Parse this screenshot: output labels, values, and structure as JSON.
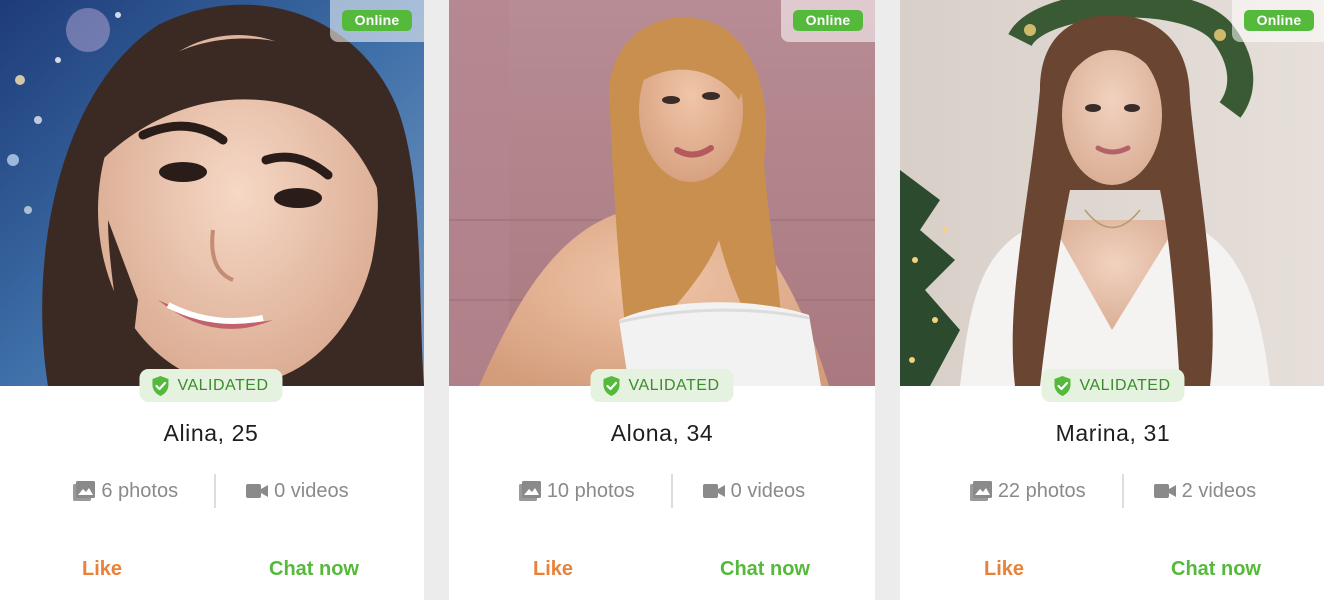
{
  "profiles": [
    {
      "status": "Online",
      "badge": "VALIDATED",
      "name": "Alina, 25",
      "photos": "6 photos",
      "videos": "0 videos",
      "like": "Like",
      "chat": "Chat now"
    },
    {
      "status": "Online",
      "badge": "VALIDATED",
      "name": "Alona, 34",
      "photos": "10 photos",
      "videos": "0 videos",
      "like": "Like",
      "chat": "Chat now"
    },
    {
      "status": "Online",
      "badge": "VALIDATED",
      "name": "Marina, 31",
      "photos": "22 photos",
      "videos": "2 videos",
      "like": "Like",
      "chat": "Chat now"
    }
  ],
  "colors": {
    "online": "#55b93b",
    "validated_bg": "#e5f2df",
    "validated_text": "#3b8c2c",
    "like": "#e8823a",
    "chat": "#55b93b",
    "stats_text": "#8a8a8a"
  },
  "icons": [
    "shield-check-icon",
    "photos-icon",
    "video-camera-icon"
  ]
}
